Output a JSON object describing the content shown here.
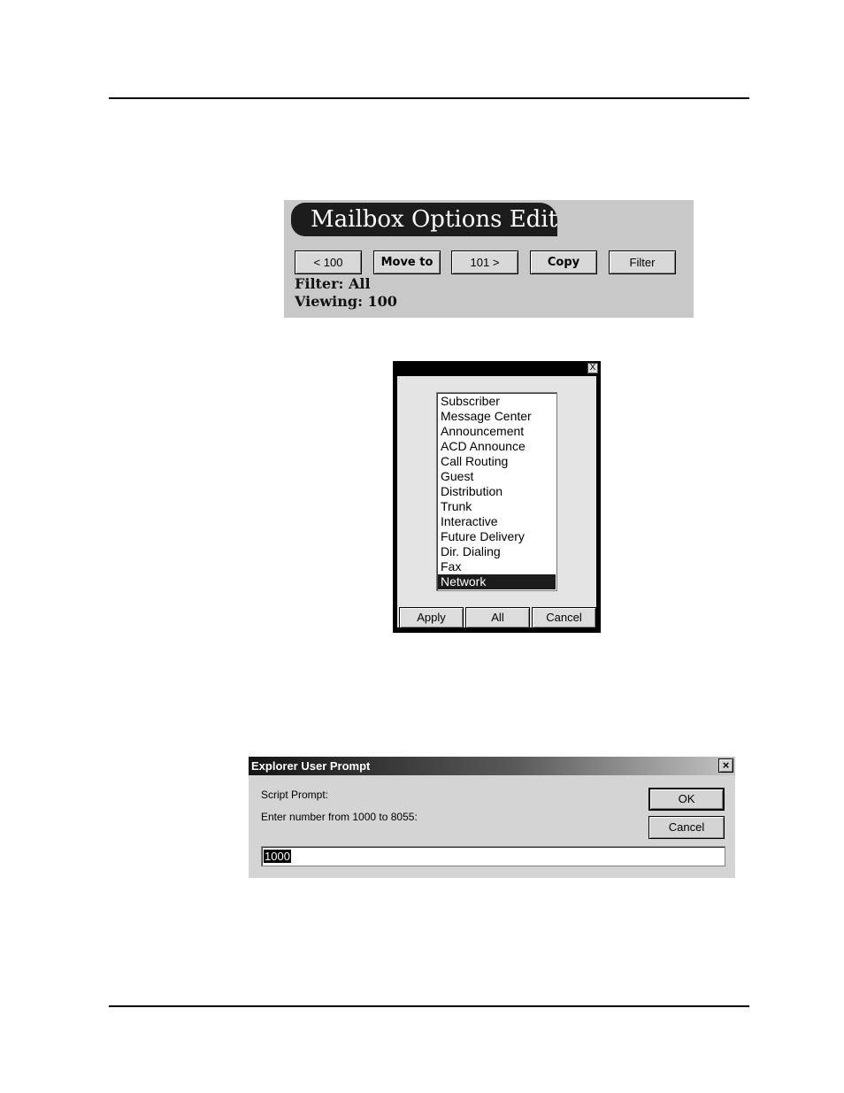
{
  "mailbox_options": {
    "title": "Mailbox Options Edit",
    "buttons": {
      "prev": "< 100",
      "move_to": "Move to",
      "next": "101 >",
      "copy": "Copy",
      "filter": "Filter"
    },
    "filter_line": "Filter: All",
    "viewing_line": "Viewing: 100"
  },
  "filter_dialog": {
    "close": "X",
    "items": [
      "Subscriber",
      "Message Center",
      "Announcement",
      "ACD Announce",
      "Call Routing",
      "Guest",
      "Distribution",
      "Trunk",
      "Interactive",
      "Future Delivery",
      "Dir. Dialing",
      "Fax",
      "Network"
    ],
    "selected_item": "Network",
    "buttons": {
      "apply": "Apply",
      "all": "All",
      "cancel": "Cancel"
    }
  },
  "prompt_dialog": {
    "title": "Explorer User Prompt",
    "close": "×",
    "script_prompt": "Script Prompt:",
    "message": "Enter number from 1000 to 8055:",
    "ok": "OK",
    "cancel": "Cancel",
    "input_value": "1000"
  }
}
